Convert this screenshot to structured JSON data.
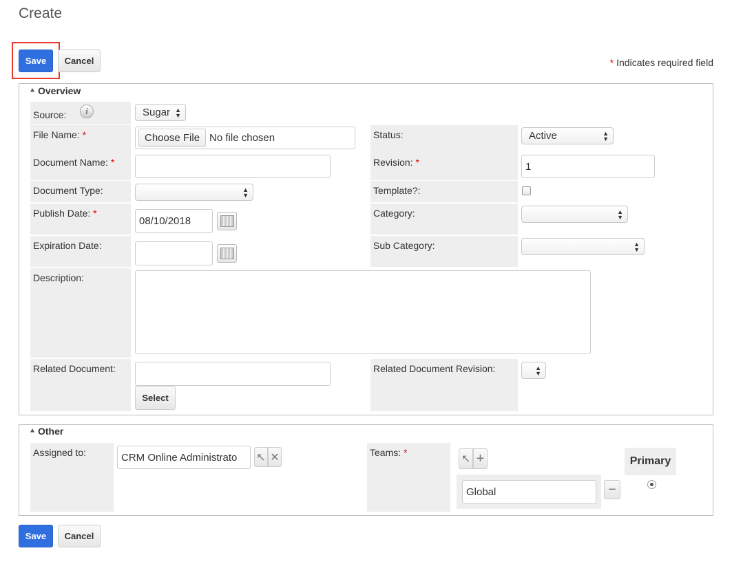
{
  "header": {
    "title": "Create"
  },
  "toolbar": {
    "save_label": "Save",
    "cancel_label": "Cancel",
    "required_star": "*",
    "required_note": "Indicates required field"
  },
  "overview": {
    "title": "Overview",
    "source_label": "Source:",
    "source_value": "Sugar",
    "file_name_label": "File Name:",
    "choose_file_label": "Choose File",
    "no_file_text": "No file chosen",
    "status_label": "Status:",
    "status_value": "Active",
    "document_name_label": "Document Name:",
    "document_name_value": "",
    "revision_label": "Revision:",
    "revision_value": "1",
    "document_type_label": "Document Type:",
    "document_type_value": "",
    "template_label": "Template?:",
    "publish_date_label": "Publish Date:",
    "publish_date_value": "08/10/2018",
    "category_label": "Category:",
    "category_value": "",
    "expiration_date_label": "Expiration Date:",
    "expiration_date_value": "",
    "sub_category_label": "Sub Category:",
    "sub_category_value": "",
    "description_label": "Description:",
    "description_value": "",
    "related_document_label": "Related Document:",
    "related_document_value": "",
    "select_label": "Select",
    "related_revision_label": "Related Document Revision:",
    "related_revision_value": ""
  },
  "other": {
    "title": "Other",
    "assigned_to_label": "Assigned to:",
    "assigned_to_value": "CRM Online Administrato",
    "teams_label": "Teams:",
    "primary_label": "Primary",
    "team_value": "Global"
  },
  "icons": {
    "info": "info-icon",
    "collapse": "chevron-up-icon",
    "calendar": "calendar-icon",
    "select": "arrow-cursor-icon",
    "clear": "close-icon",
    "add": "plus-icon",
    "remove": "minus-icon"
  },
  "colors": {
    "primary_button": "#2f6fe0",
    "highlight": "#e8392a",
    "required": "#dd0000",
    "label_bg": "#eeeeee"
  }
}
